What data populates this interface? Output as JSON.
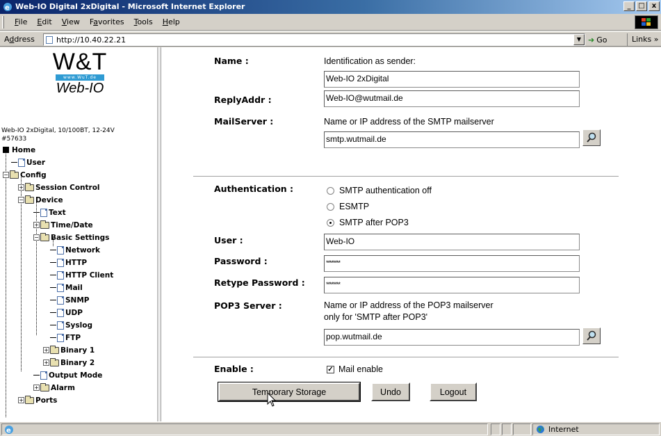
{
  "window": {
    "title": "Web-IO Digital 2xDigital - Microsoft Internet Explorer"
  },
  "menu": {
    "items": [
      {
        "pre": "",
        "u": "F",
        "post": "ile"
      },
      {
        "pre": "",
        "u": "E",
        "post": "dit"
      },
      {
        "pre": "",
        "u": "V",
        "post": "iew"
      },
      {
        "pre": "F",
        "u": "a",
        "post": "vorites"
      },
      {
        "pre": "",
        "u": "T",
        "post": "ools"
      },
      {
        "pre": "",
        "u": "H",
        "post": "elp"
      }
    ]
  },
  "address": {
    "label": "Address",
    "label_u": "d",
    "url": "http://10.40.22.21",
    "go": "Go",
    "links": "Links »"
  },
  "logo": {
    "brand": "W&T",
    "strip": "www.WuT.de",
    "product": "Web-IO"
  },
  "device": {
    "line1": "Web-IO 2xDigital, 10/100BT, 12-24V",
    "line2": "#57633"
  },
  "tree": [
    "Home",
    "User",
    "Config",
    "Session Control",
    "Device",
    "Text",
    "Time/Date",
    "Basic Settings",
    "Network",
    "HTTP",
    "HTTP Client",
    "Mail",
    "SNMP",
    "UDP",
    "Syslog",
    "FTP",
    "Binary 1",
    "Binary 2",
    "Output Mode",
    "Alarm",
    "Ports"
  ],
  "form": {
    "name_label": "Name :",
    "name_hint": "Identification as sender:",
    "name_value": "Web-IO 2xDigital",
    "reply_label": "ReplyAddr :",
    "reply_value": "Web-IO@wutmail.de",
    "mailserver_label": "MailServer :",
    "mailserver_hint": "Name or IP address of the SMTP mailserver",
    "mailserver_value": "smtp.wutmail.de",
    "auth_label": "Authentication :",
    "auth_options": [
      "SMTP authentication off",
      "ESMTP",
      "SMTP after POP3"
    ],
    "auth_selected": "SMTP after POP3",
    "user_label": "User :",
    "user_value": "Web-IO",
    "password_label": "Password :",
    "password_value": "********",
    "retype_label": "Retype Password :",
    "retype_value": "********",
    "pop3_label": "POP3 Server :",
    "pop3_hint1": "Name or IP address of the POP3 mailserver",
    "pop3_hint2": "only for 'SMTP after POP3'",
    "pop3_value": "pop.wutmail.de",
    "enable_label": "Enable :",
    "enable_option": "Mail enable",
    "enable_checked": true
  },
  "buttons": {
    "storage": "Temporary Storage",
    "undo": "Undo",
    "logout": "Logout"
  },
  "status": {
    "zone": "Internet"
  }
}
